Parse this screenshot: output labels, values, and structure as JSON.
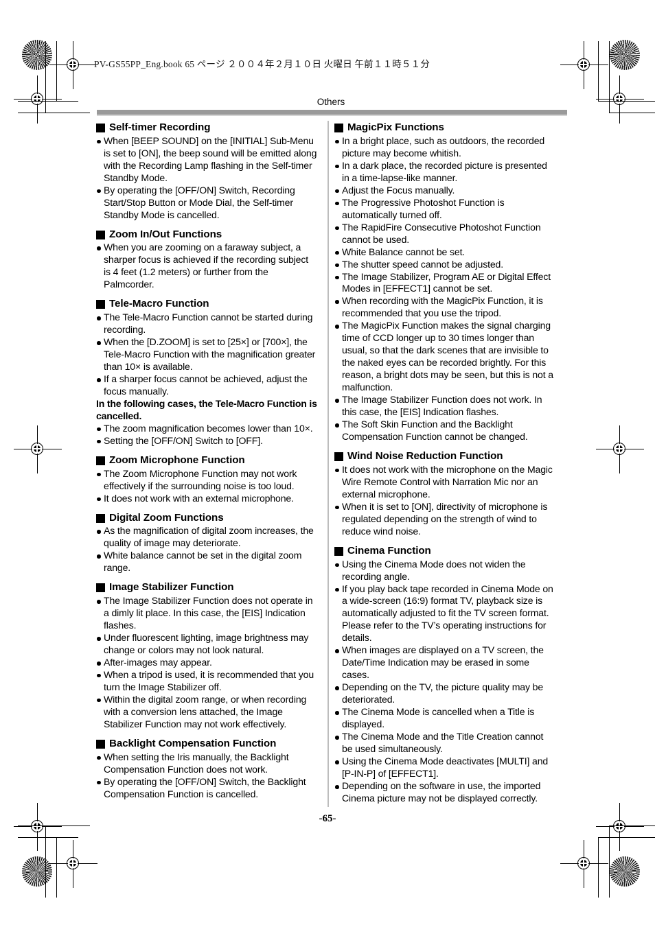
{
  "book_header": "PV-GS55PP_Eng.book  65 ページ  ２００４年２月１０日  火曜日  午前１１時５１分",
  "running_head": "Others",
  "folio": "-65-",
  "left_column": {
    "sections": [
      {
        "heading": "Self-timer Recording",
        "items": [
          "When [BEEP SOUND] on the [INITIAL] Sub-Menu is set to [ON], the beep sound will be emitted along with the Recording Lamp flashing in the Self-timer Standby Mode.",
          "By operating the [OFF/ON] Switch, Recording Start/Stop Button or Mode Dial, the Self-timer Standby Mode is cancelled."
        ]
      },
      {
        "heading": "Zoom In/Out Functions",
        "items": [
          "When you are zooming on a faraway subject, a sharper focus is achieved if the recording subject is 4 feet (1.2 meters) or further from the Palmcorder."
        ]
      },
      {
        "heading": "Tele-Macro Function",
        "items": [
          "The Tele-Macro Function cannot be started during recording.",
          "When the [D.ZOOM] is set to [25×] or [700×], the Tele-Macro Function with the magnification greater than 10× is available.",
          "If a sharper focus cannot be achieved, adjust the focus manually."
        ],
        "note": "In the following cases, the Tele-Macro Function is cancelled.",
        "items_after_note": [
          "The zoom magnification becomes lower than 10×.",
          "Setting the [OFF/ON] Switch to [OFF]."
        ]
      },
      {
        "heading": "Zoom Microphone Function",
        "items": [
          "The Zoom Microphone Function may not work effectively if the surrounding noise is too loud.",
          "It does not work with an external microphone."
        ]
      },
      {
        "heading": "Digital Zoom Functions",
        "items": [
          "As the magnification of digital zoom increases, the quality of image may deteriorate.",
          "White balance cannot be set in the digital zoom range."
        ]
      },
      {
        "heading": "Image Stabilizer Function",
        "items": [
          "The Image Stabilizer Function does not operate in a dimly lit place. In this case, the [EIS] Indication flashes.",
          "Under fluorescent lighting, image brightness may change or colors may not look natural.",
          "After-images may appear.",
          "When a tripod is used, it is recommended that you turn the Image Stabilizer off.",
          "Within the digital zoom range, or when recording with a conversion lens attached, the Image Stabilizer Function may not work effectively."
        ]
      },
      {
        "heading": "Backlight Compensation Function",
        "items": [
          "When setting the Iris manually, the Backlight Compensation Function does not work.",
          "By operating the [OFF/ON] Switch, the Backlight Compensation Function is cancelled."
        ]
      }
    ]
  },
  "right_column": {
    "sections": [
      {
        "heading": "MagicPix Functions",
        "items": [
          "In a bright place, such as outdoors, the recorded picture may become whitish.",
          "In a dark place, the recorded picture is presented in a time-lapse-like manner.",
          "Adjust the Focus manually.",
          "The Progressive Photoshot Function is automatically turned off.",
          "The RapidFire Consecutive Photoshot Function cannot be used.",
          "White Balance cannot be set.",
          "The shutter speed cannot be adjusted.",
          "The Image Stabilizer, Program AE or Digital Effect Modes in [EFFECT1] cannot be set.",
          "When recording with the MagicPix Function, it is recommended that you use the tripod.",
          "The MagicPix Function makes the signal charging time of CCD longer up to 30 times longer than usual, so that the dark scenes that are invisible to the naked eyes can be recorded brightly. For this reason, a bright dots may be seen, but this is not a malfunction.",
          "The Image Stabilizer Function does not work. In this case, the [EIS] Indication flashes.",
          "The Soft Skin Function and the Backlight Compensation Function cannot be changed."
        ]
      },
      {
        "heading": "Wind Noise Reduction Function",
        "items": [
          "It does not work with the microphone on the Magic Wire Remote Control with Narration Mic nor an external microphone.",
          "When it is set to [ON], directivity of microphone is regulated depending on the strength of wind to reduce wind noise."
        ]
      },
      {
        "heading": "Cinema Function",
        "items": [
          "Using the Cinema Mode does not widen the recording angle.",
          "If you play back tape recorded in Cinema Mode on a wide-screen (16:9) format TV, playback size is automatically adjusted to fit the TV screen format. Please refer to the TV’s operating instructions for details.",
          "When images are displayed on a TV screen, the Date/Time Indication may be erased in some cases.",
          "Depending on the TV, the picture quality may be deteriorated.",
          "The Cinema Mode is cancelled when a Title is displayed.",
          "The Cinema Mode and the Title Creation cannot be used simultaneously.",
          "Using the Cinema Mode deactivates [MULTI] and [P-IN-P] of [EFFECT1].",
          "Depending on the software in use, the imported Cinema picture may not be displayed correctly."
        ]
      }
    ]
  },
  "colors": {
    "rule": "#9a9a9a",
    "divider": "#bdbdbd",
    "text": "#000000"
  }
}
